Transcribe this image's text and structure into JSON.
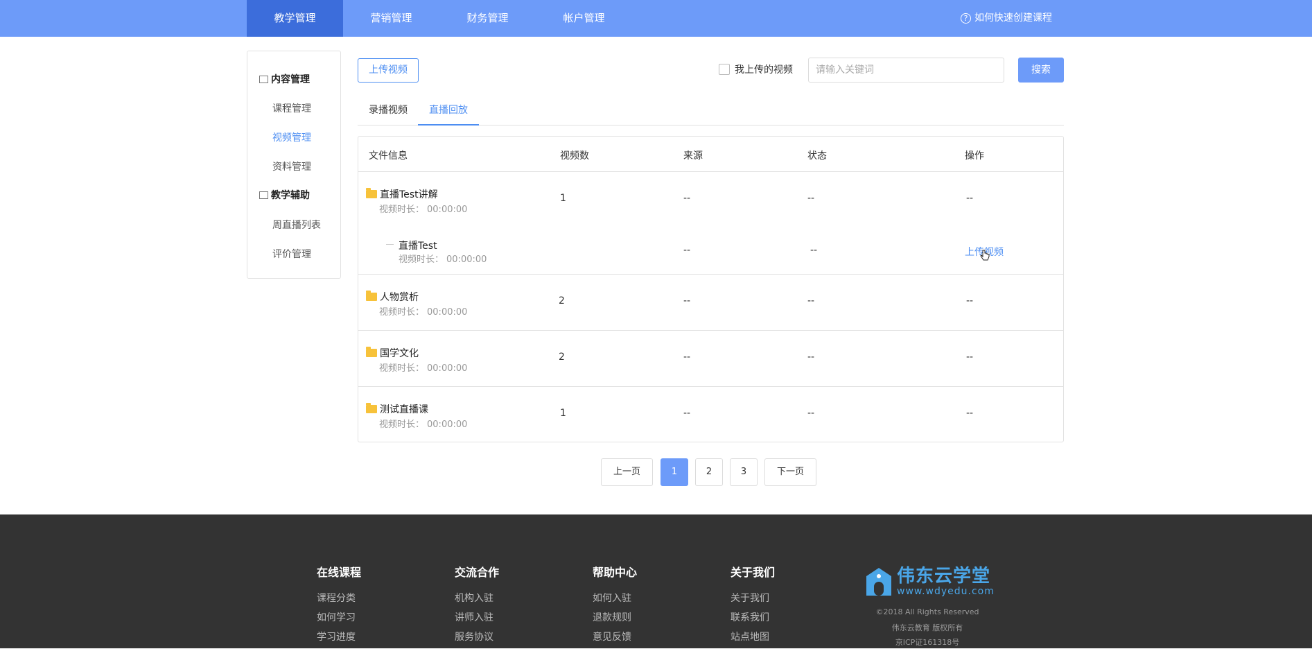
{
  "topnav": {
    "items": [
      "教学管理",
      "营销管理",
      "财务管理",
      "帐户管理"
    ],
    "help_link": "如何快速创建课程"
  },
  "sidebar": {
    "group1": "内容管理",
    "items1": [
      "课程管理",
      "视频管理",
      "资料管理"
    ],
    "group2": "教学辅助",
    "items2": [
      "周直播列表",
      "评价管理"
    ]
  },
  "toolbar": {
    "upload_label": "上传视频",
    "my_upload_label": "我上传的视频",
    "search_placeholder": "请输入关键词",
    "search_label": "搜索"
  },
  "tabs": [
    "录播视频",
    "直播回放"
  ],
  "table": {
    "headers": [
      "文件信息",
      "视频数",
      "来源",
      "状态",
      "操作"
    ],
    "duration_label": "视频时长：",
    "rows": [
      {
        "name": "直播Test讲解",
        "duration": "00:00:00",
        "count": "1",
        "source": "--",
        "status": "--",
        "op": "--"
      },
      {
        "name": "直播Test",
        "duration": "00:00:00",
        "source": "--",
        "status": "--",
        "op": "上传视频"
      },
      {
        "name": "人物赏析",
        "duration": "00:00:00",
        "count": "2",
        "source": "--",
        "status": "--",
        "op": "--"
      },
      {
        "name": "国学文化",
        "duration": "00:00:00",
        "count": "2",
        "source": "--",
        "status": "--",
        "op": "--"
      },
      {
        "name": "测试直播课",
        "duration": "00:00:00",
        "count": "1",
        "source": "--",
        "status": "--",
        "op": "--"
      }
    ]
  },
  "pagination": {
    "prev": "上一页",
    "pages": [
      "1",
      "2",
      "3"
    ],
    "next": "下一页",
    "current": "1"
  },
  "footer": {
    "columns": [
      {
        "title": "在线课程",
        "links": [
          "课程分类",
          "如何学习",
          "学习进度"
        ]
      },
      {
        "title": "交流合作",
        "links": [
          "机构入驻",
          "讲师入驻",
          "服务协议"
        ]
      },
      {
        "title": "帮助中心",
        "links": [
          "如何入驻",
          "退款规则",
          "意见反馈"
        ]
      },
      {
        "title": "关于我们",
        "links": [
          "关于我们",
          "联系我们",
          "站点地图"
        ]
      }
    ],
    "brand": "伟东云学堂",
    "url": "www.wdyedu.com",
    "copyright": "©2018 All Rights Reserved",
    "company": "伟东云教育 版权所有",
    "icp": "京ICP证161318号"
  },
  "colors": {
    "accent": "#6d9bf9",
    "active_nav": "#3c6ddb",
    "link": "#4d8ef2",
    "folder": "#f7c23a",
    "footer_bg": "#333333"
  }
}
